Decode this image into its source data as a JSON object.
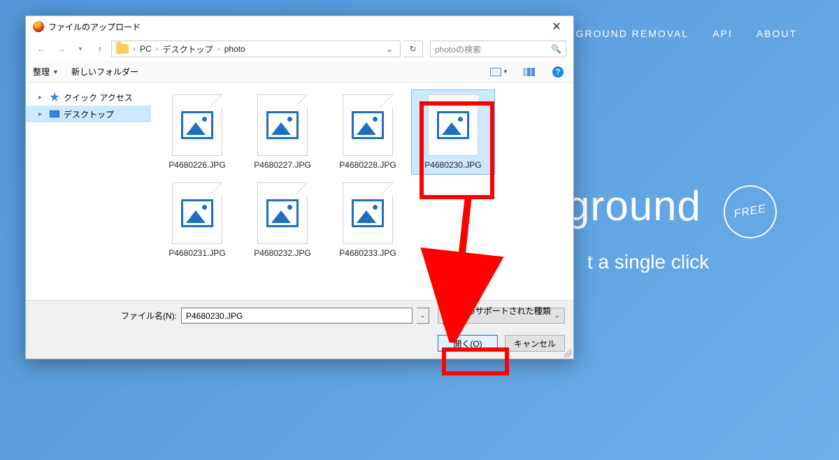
{
  "bg": {
    "nav": {
      "item1": "GROUND REMOVAL",
      "item2": "API",
      "item3": "ABOUT"
    },
    "hero_title": "ground",
    "hero_sub": "t a single click",
    "free": "FREE"
  },
  "dialog": {
    "title": "ファイルのアップロード",
    "breadcrumb": {
      "root": "PC",
      "mid": "デスクトップ",
      "leaf": "photo"
    },
    "search_placeholder": "photoの検索",
    "toolbar": {
      "organize": "整理",
      "newfolder": "新しいフォルダー"
    },
    "sidebar": {
      "quick": "クイック アクセス",
      "desktop": "デスクトップ"
    },
    "files": [
      {
        "name": "P4680226.JPG",
        "selected": false
      },
      {
        "name": "P4680227.JPG",
        "selected": false
      },
      {
        "name": "P4680228.JPG",
        "selected": false
      },
      {
        "name": "P4680230.JPG",
        "selected": true
      },
      {
        "name": "P4680231.JPG",
        "selected": false
      },
      {
        "name": "P4680232.JPG",
        "selected": false
      },
      {
        "name": "P4680233.JPG",
        "selected": false
      }
    ],
    "filename_label": "ファイル名(N):",
    "filename_value": "P4680230.JPG",
    "filetype_label": "すべてのサポートされた種類 (*.jpg;*",
    "open_btn": "開く(O)",
    "cancel_btn": "キャンセル"
  }
}
